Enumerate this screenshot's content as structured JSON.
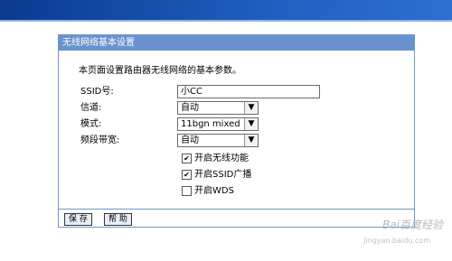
{
  "panel": {
    "title": "无线网络基本设置",
    "intro": "本页面设置路由器无线网络的基本参数。"
  },
  "fields": {
    "ssid": {
      "label": "SSID号:",
      "value": "小CC"
    },
    "channel": {
      "label": "信道:",
      "value": "自动"
    },
    "mode": {
      "label": "模式:",
      "value": "11bgn mixed"
    },
    "bandwidth": {
      "label": "频段带宽:",
      "value": "自动"
    }
  },
  "checkboxes": [
    {
      "label": "开启无线功能",
      "checked": true
    },
    {
      "label": "开启SSID广播",
      "checked": true
    },
    {
      "label": "开启WDS",
      "checked": false
    }
  ],
  "buttons": {
    "save": "保 存",
    "help": "帮 助"
  },
  "watermark": {
    "brand": "Bai百度经验",
    "url": "jingyan.baidu.com"
  },
  "colors": {
    "title_bg": "#6a92cf",
    "panel_border": "#6f95cc"
  }
}
